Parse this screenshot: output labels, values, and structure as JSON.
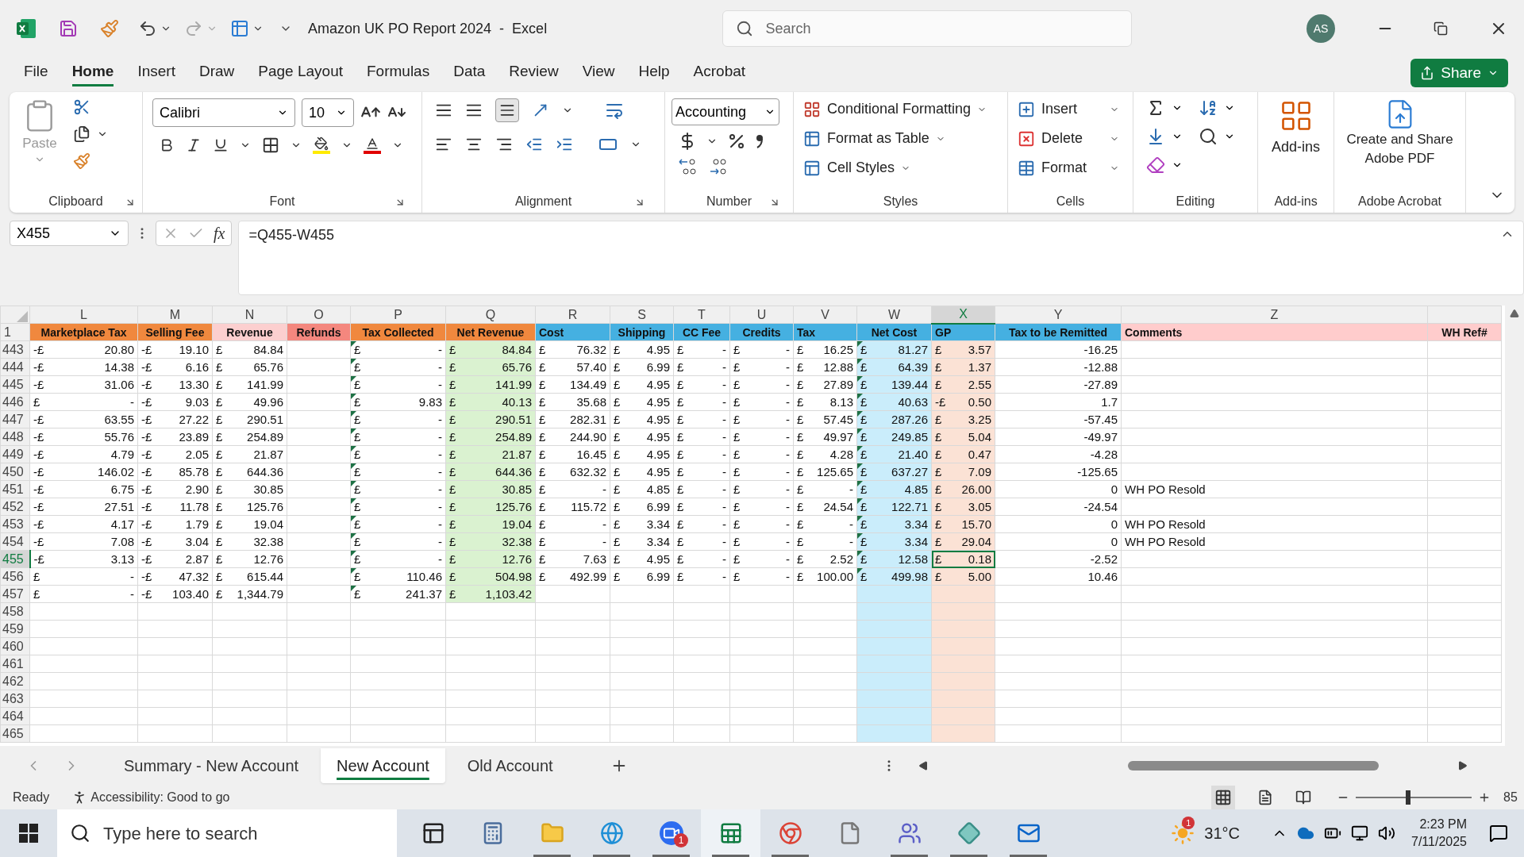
{
  "window": {
    "title": "Amazon UK PO Report 2024  -  Excel",
    "search_placeholder": "Search",
    "avatar": "AS"
  },
  "menu": [
    {
      "label": "File",
      "selected": false
    },
    {
      "label": "Home",
      "selected": true
    },
    {
      "label": "Insert",
      "selected": false
    },
    {
      "label": "Draw",
      "selected": false
    },
    {
      "label": "Page Layout",
      "selected": false
    },
    {
      "label": "Formulas",
      "selected": false
    },
    {
      "label": "Data",
      "selected": false
    },
    {
      "label": "Review",
      "selected": false
    },
    {
      "label": "View",
      "selected": false
    },
    {
      "label": "Help",
      "selected": false
    },
    {
      "label": "Acrobat",
      "selected": false
    }
  ],
  "share": "Share",
  "ribbon": {
    "paste": "Paste",
    "font_name": "Calibri",
    "font_size": "10",
    "number_format": "Accounting",
    "styles": [
      "Conditional Formatting",
      "Format as Table",
      "Cell Styles"
    ],
    "cells": [
      "Insert",
      "Delete",
      "Format"
    ],
    "addins": "Add-ins",
    "adobe": "Create and Share Adobe PDF",
    "groups": [
      "Clipboard",
      "Font",
      "Alignment",
      "Number",
      "Styles",
      "Cells",
      "Editing",
      "Add-ins",
      "Adobe Acrobat"
    ]
  },
  "formula_bar": {
    "name_box": "X455",
    "function_label": "fx",
    "formula": "=Q455-W455"
  },
  "sheet": {
    "header_row_number": "1",
    "columns": [
      {
        "letter": "L",
        "header": "Marketplace Tax",
        "color": "#f0883e",
        "kind": "acct",
        "selected": false
      },
      {
        "letter": "M",
        "header": "Selling Fee",
        "color": "#f0883e",
        "kind": "acct",
        "selected": false
      },
      {
        "letter": "N",
        "header": "Revenue",
        "color": "#fccfcf",
        "kind": "acct",
        "selected": false
      },
      {
        "letter": "O",
        "header": "Refunds",
        "color": "#f4877e",
        "selected": false
      },
      {
        "letter": "P",
        "header": "Tax Collected",
        "color": "#f0883e",
        "kind": "acct",
        "flagged": true,
        "selected": false
      },
      {
        "letter": "Q",
        "header": "Net Revenue",
        "color": "#f0883e",
        "kind": "acct",
        "body": {
          "color": "#daf2d0",
          "fill_empty": false
        },
        "selected": false
      },
      {
        "letter": "R",
        "header": "Cost",
        "color": "#45b0e1",
        "kind": "acct",
        "selected": false
      },
      {
        "letter": "S",
        "header": "Shipping",
        "color": "#45b0e1",
        "kind": "acct",
        "selected": false
      },
      {
        "letter": "T",
        "header": "CC Fee",
        "color": "#45b0e1",
        "kind": "acct",
        "selected": false
      },
      {
        "letter": "U",
        "header": "Credits",
        "color": "#45b0e1",
        "kind": "acct",
        "selected": false
      },
      {
        "letter": "V",
        "header": "Tax",
        "color": "#45b0e1",
        "kind": "acct",
        "selected": false
      },
      {
        "letter": "W",
        "header": "Net Cost",
        "color": "#45b0e1",
        "kind": "acct",
        "flagged": true,
        "body": {
          "color": "#caedfb",
          "fill_empty": true
        },
        "selected": false
      },
      {
        "letter": "X",
        "header": "GP",
        "color": "#45b0e1",
        "kind": "acct",
        "body": {
          "color": "#fbe2d5",
          "fill_empty": true
        },
        "selected": true
      },
      {
        "letter": "Y",
        "header": "Tax to be Remitted",
        "color": "#45b0e1",
        "kind": "number",
        "selected": false
      },
      {
        "letter": "Z",
        "header": "Comments",
        "color": "#ffcccc",
        "kind": "text",
        "selected": false
      },
      {
        "header": "WH Ref#",
        "color": "#ffcccc",
        "selected": false
      }
    ],
    "rows": [
      {
        "number": "443",
        "selected": false,
        "cells": [
          [
            "-£",
            "20.80"
          ],
          [
            "-£",
            "19.10"
          ],
          [
            "£",
            "84.84"
          ],
          null,
          [
            "£",
            "-"
          ],
          [
            "£",
            "84.84"
          ],
          [
            "£",
            "76.32"
          ],
          [
            "£",
            "4.95"
          ],
          [
            "£",
            "-"
          ],
          [
            "£",
            "-"
          ],
          [
            "£",
            "16.25"
          ],
          [
            "£",
            "81.27"
          ],
          [
            "£",
            "3.57"
          ],
          "-16.25",
          null,
          null
        ]
      },
      {
        "number": "444",
        "selected": false,
        "cells": [
          [
            "-£",
            "14.38"
          ],
          [
            "-£",
            "6.16"
          ],
          [
            "£",
            "65.76"
          ],
          null,
          [
            "£",
            "-"
          ],
          [
            "£",
            "65.76"
          ],
          [
            "£",
            "57.40"
          ],
          [
            "£",
            "6.99"
          ],
          [
            "£",
            "-"
          ],
          [
            "£",
            "-"
          ],
          [
            "£",
            "12.88"
          ],
          [
            "£",
            "64.39"
          ],
          [
            "£",
            "1.37"
          ],
          "-12.88",
          null,
          null
        ]
      },
      {
        "number": "445",
        "selected": false,
        "cells": [
          [
            "-£",
            "31.06"
          ],
          [
            "-£",
            "13.30"
          ],
          [
            "£",
            "141.99"
          ],
          null,
          [
            "£",
            "-"
          ],
          [
            "£",
            "141.99"
          ],
          [
            "£",
            "134.49"
          ],
          [
            "£",
            "4.95"
          ],
          [
            "£",
            "-"
          ],
          [
            "£",
            "-"
          ],
          [
            "£",
            "27.89"
          ],
          [
            "£",
            "139.44"
          ],
          [
            "£",
            "2.55"
          ],
          "-27.89",
          null,
          null
        ]
      },
      {
        "number": "446",
        "selected": false,
        "cells": [
          [
            "£",
            "-"
          ],
          [
            "-£",
            "9.03"
          ],
          [
            "£",
            "49.96"
          ],
          null,
          [
            "£",
            "9.83"
          ],
          [
            "£",
            "40.13"
          ],
          [
            "£",
            "35.68"
          ],
          [
            "£",
            "4.95"
          ],
          [
            "£",
            "-"
          ],
          [
            "£",
            "-"
          ],
          [
            "£",
            "8.13"
          ],
          [
            "£",
            "40.63"
          ],
          [
            "-£",
            "0.50"
          ],
          "1.7",
          null,
          null
        ]
      },
      {
        "number": "447",
        "selected": false,
        "cells": [
          [
            "-£",
            "63.55"
          ],
          [
            "-£",
            "27.22"
          ],
          [
            "£",
            "290.51"
          ],
          null,
          [
            "£",
            "-"
          ],
          [
            "£",
            "290.51"
          ],
          [
            "£",
            "282.31"
          ],
          [
            "£",
            "4.95"
          ],
          [
            "£",
            "-"
          ],
          [
            "£",
            "-"
          ],
          [
            "£",
            "57.45"
          ],
          [
            "£",
            "287.26"
          ],
          [
            "£",
            "3.25"
          ],
          "-57.45",
          null,
          null
        ]
      },
      {
        "number": "448",
        "selected": false,
        "cells": [
          [
            "-£",
            "55.76"
          ],
          [
            "-£",
            "23.89"
          ],
          [
            "£",
            "254.89"
          ],
          null,
          [
            "£",
            "-"
          ],
          [
            "£",
            "254.89"
          ],
          [
            "£",
            "244.90"
          ],
          [
            "£",
            "4.95"
          ],
          [
            "£",
            "-"
          ],
          [
            "£",
            "-"
          ],
          [
            "£",
            "49.97"
          ],
          [
            "£",
            "249.85"
          ],
          [
            "£",
            "5.04"
          ],
          "-49.97",
          null,
          null
        ]
      },
      {
        "number": "449",
        "selected": false,
        "cells": [
          [
            "-£",
            "4.79"
          ],
          [
            "-£",
            "2.05"
          ],
          [
            "£",
            "21.87"
          ],
          null,
          [
            "£",
            "-"
          ],
          [
            "£",
            "21.87"
          ],
          [
            "£",
            "16.45"
          ],
          [
            "£",
            "4.95"
          ],
          [
            "£",
            "-"
          ],
          [
            "£",
            "-"
          ],
          [
            "£",
            "4.28"
          ],
          [
            "£",
            "21.40"
          ],
          [
            "£",
            "0.47"
          ],
          "-4.28",
          null,
          null
        ]
      },
      {
        "number": "450",
        "selected": false,
        "cells": [
          [
            "-£",
            "146.02"
          ],
          [
            "-£",
            "85.78"
          ],
          [
            "£",
            "644.36"
          ],
          null,
          [
            "£",
            "-"
          ],
          [
            "£",
            "644.36"
          ],
          [
            "£",
            "632.32"
          ],
          [
            "£",
            "4.95"
          ],
          [
            "£",
            "-"
          ],
          [
            "£",
            "-"
          ],
          [
            "£",
            "125.65"
          ],
          [
            "£",
            "637.27"
          ],
          [
            "£",
            "7.09"
          ],
          "-125.65",
          null,
          null
        ]
      },
      {
        "number": "451",
        "selected": false,
        "cells": [
          [
            "-£",
            "6.75"
          ],
          [
            "-£",
            "2.90"
          ],
          [
            "£",
            "30.85"
          ],
          null,
          [
            "£",
            "-"
          ],
          [
            "£",
            "30.85"
          ],
          [
            "£",
            "-"
          ],
          [
            "£",
            "4.85"
          ],
          [
            "£",
            "-"
          ],
          [
            "£",
            "-"
          ],
          [
            "£",
            "-"
          ],
          [
            "£",
            "4.85"
          ],
          [
            "£",
            "26.00"
          ],
          "0",
          "WH PO Resold",
          null
        ]
      },
      {
        "number": "452",
        "selected": false,
        "cells": [
          [
            "-£",
            "27.51"
          ],
          [
            "-£",
            "11.78"
          ],
          [
            "£",
            "125.76"
          ],
          null,
          [
            "£",
            "-"
          ],
          [
            "£",
            "125.76"
          ],
          [
            "£",
            "115.72"
          ],
          [
            "£",
            "6.99"
          ],
          [
            "£",
            "-"
          ],
          [
            "£",
            "-"
          ],
          [
            "£",
            "24.54"
          ],
          [
            "£",
            "122.71"
          ],
          [
            "£",
            "3.05"
          ],
          "-24.54",
          null,
          null
        ]
      },
      {
        "number": "453",
        "selected": false,
        "cells": [
          [
            "-£",
            "4.17"
          ],
          [
            "-£",
            "1.79"
          ],
          [
            "£",
            "19.04"
          ],
          null,
          [
            "£",
            "-"
          ],
          [
            "£",
            "19.04"
          ],
          [
            "£",
            "-"
          ],
          [
            "£",
            "3.34"
          ],
          [
            "£",
            "-"
          ],
          [
            "£",
            "-"
          ],
          [
            "£",
            "-"
          ],
          [
            "£",
            "3.34"
          ],
          [
            "£",
            "15.70"
          ],
          "0",
          "WH PO Resold",
          null
        ]
      },
      {
        "number": "454",
        "selected": false,
        "cells": [
          [
            "-£",
            "7.08"
          ],
          [
            "-£",
            "3.04"
          ],
          [
            "£",
            "32.38"
          ],
          null,
          [
            "£",
            "-"
          ],
          [
            "£",
            "32.38"
          ],
          [
            "£",
            "-"
          ],
          [
            "£",
            "3.34"
          ],
          [
            "£",
            "-"
          ],
          [
            "£",
            "-"
          ],
          [
            "£",
            "-"
          ],
          [
            "£",
            "3.34"
          ],
          [
            "£",
            "29.04"
          ],
          "0",
          "WH PO Resold",
          null
        ]
      },
      {
        "number": "455",
        "selected": true,
        "cells": [
          [
            "-£",
            "3.13"
          ],
          [
            "-£",
            "2.87"
          ],
          [
            "£",
            "12.76"
          ],
          null,
          [
            "£",
            "-"
          ],
          [
            "£",
            "12.76"
          ],
          [
            "£",
            "7.63"
          ],
          [
            "£",
            "4.95"
          ],
          [
            "£",
            "-"
          ],
          [
            "£",
            "-"
          ],
          [
            "£",
            "2.52"
          ],
          [
            "£",
            "12.58"
          ],
          [
            "£",
            "0.18"
          ],
          "-2.52",
          null,
          null
        ]
      },
      {
        "number": "456",
        "selected": false,
        "cells": [
          [
            "£",
            "-"
          ],
          [
            "-£",
            "47.32"
          ],
          [
            "£",
            "615.44"
          ],
          null,
          [
            "£",
            "110.46"
          ],
          [
            "£",
            "504.98"
          ],
          [
            "£",
            "492.99"
          ],
          [
            "£",
            "6.99"
          ],
          [
            "£",
            "-"
          ],
          [
            "£",
            "-"
          ],
          [
            "£",
            "100.00"
          ],
          [
            "£",
            "499.98"
          ],
          [
            "£",
            "5.00"
          ],
          "10.46",
          null,
          null
        ]
      },
      {
        "number": "457",
        "selected": false,
        "cells": [
          [
            "£",
            "-"
          ],
          [
            "-£",
            "103.40"
          ],
          [
            "£",
            "1,344.79"
          ],
          null,
          [
            "£",
            "241.37"
          ],
          [
            "£",
            "1,103.42"
          ],
          null,
          null,
          null,
          null,
          null,
          null,
          null,
          null,
          null,
          null
        ]
      },
      {
        "number": "458",
        "selected": false,
        "cells": []
      },
      {
        "number": "459",
        "selected": false,
        "cells": []
      },
      {
        "number": "460",
        "selected": false,
        "cells": []
      },
      {
        "number": "461",
        "selected": false,
        "cells": []
      },
      {
        "number": "462",
        "selected": false,
        "cells": []
      },
      {
        "number": "463",
        "selected": false,
        "cells": []
      },
      {
        "number": "464",
        "selected": false,
        "cells": []
      },
      {
        "number": "465",
        "selected": false,
        "cells": []
      }
    ]
  },
  "sheet_tabs": [
    {
      "label": "Summary - New Account",
      "selected": false
    },
    {
      "label": "New Account",
      "selected": true
    },
    {
      "label": "Old Account",
      "selected": false
    }
  ],
  "status_bar": {
    "status": "Ready",
    "accessibility": "Accessibility: Good to go",
    "zoom": "85",
    "zoom_slider": {
      "level": 0.43
    }
  },
  "taskbar": {
    "search_placeholder": "Type here to search",
    "apps": [
      {
        "kind": "task-view",
        "open": false
      },
      {
        "kind": "calculator",
        "open": false
      },
      {
        "kind": "folder",
        "open": true
      },
      {
        "kind": "browser",
        "open": true
      },
      {
        "kind": "video",
        "open": true,
        "badge": "1"
      },
      {
        "kind": "spreadsheet",
        "open": true
      },
      {
        "kind": "chrome",
        "open": true
      },
      {
        "kind": "file",
        "open": false
      },
      {
        "kind": "teams",
        "open": true
      },
      {
        "kind": "diamond",
        "open": true
      },
      {
        "kind": "mail",
        "open": true
      }
    ],
    "weather": {
      "temperature": "31°C",
      "badge": "1"
    },
    "time": "2:23 PM",
    "date": "7/11/2025"
  }
}
